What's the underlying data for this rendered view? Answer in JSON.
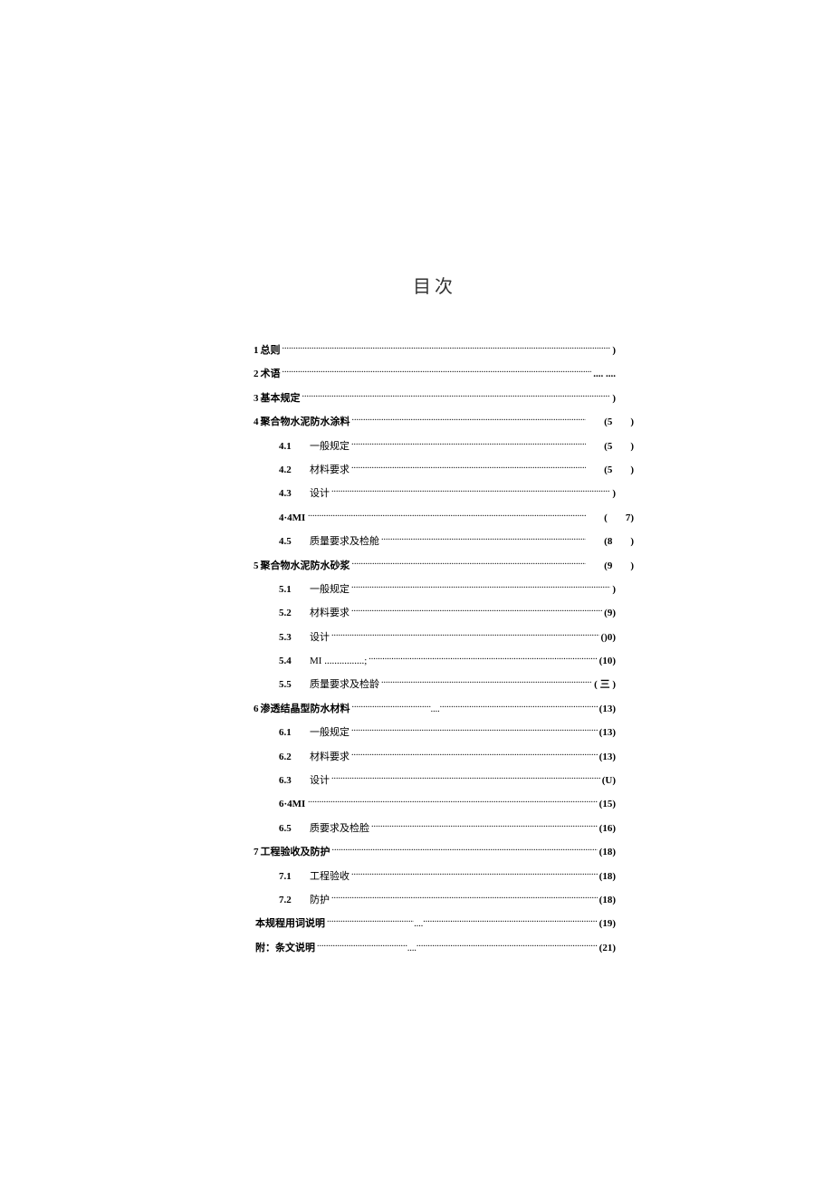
{
  "title": "目次",
  "toc": [
    {
      "type": "top",
      "num": "1",
      "label": "总则",
      "page": ")"
    },
    {
      "type": "top",
      "num": "2",
      "label": "术语",
      "page": ".... ...."
    },
    {
      "type": "top",
      "num": "3",
      "label": "基本规定",
      "page": ")"
    },
    {
      "type": "top",
      "num": "4",
      "label": "聚合物水泥防水涂料",
      "page": "(5",
      "extra": ")"
    },
    {
      "type": "sub",
      "num": "4.1",
      "label": "一般规定",
      "page": "(5",
      "extra": ")"
    },
    {
      "type": "sub",
      "num": "4.2",
      "label": "材料要求",
      "page": "(5",
      "extra": ")"
    },
    {
      "type": "sub",
      "num": "4.3",
      "label": "设计",
      "page": ")"
    },
    {
      "type": "sub",
      "num": "4·4MI",
      "label": "",
      "page": "(",
      "extra": "7)"
    },
    {
      "type": "sub",
      "num": "4.5",
      "label": "质量要求及检舱",
      "page": "(8",
      "extra": ")"
    },
    {
      "type": "top",
      "num": "5",
      "label": "聚合物水泥防水砂浆",
      "page": "(9",
      "extra": ")"
    },
    {
      "type": "sub",
      "num": "5.1",
      "label": "一般规定",
      "page": ")"
    },
    {
      "type": "sub",
      "num": "5.2",
      "label": "材料要求",
      "page": "(9)"
    },
    {
      "type": "sub",
      "num": "5.3",
      "label": "设计",
      "page": "()0)"
    },
    {
      "type": "sub",
      "num": "5.4",
      "label": "MI ................;",
      "page": "(10)"
    },
    {
      "type": "sub",
      "num": "5.5",
      "label": "质量要求及检龄",
      "page": "( 三 )"
    },
    {
      "type": "top",
      "num": "6",
      "label": "渗透结晶型防水材料",
      "gap": true,
      "page": "(13)"
    },
    {
      "type": "sub",
      "num": "6.1",
      "label": "一般规定",
      "page": "(13)"
    },
    {
      "type": "sub",
      "num": "6.2",
      "label": "材料要求",
      "page": "(13)"
    },
    {
      "type": "sub",
      "num": "6.3",
      "label": "设计",
      "page": "(U)"
    },
    {
      "type": "sub",
      "num": "6·4MI",
      "label": "",
      "page": "(15)"
    },
    {
      "type": "sub",
      "num": "6.5",
      "label": "质要求及检脸",
      "page": "(16)"
    },
    {
      "type": "top",
      "num": "7",
      "label": "工程验收及防护",
      "page": "(18)"
    },
    {
      "type": "sub",
      "num": "7.1",
      "label": "工程验收",
      "page": "(18)"
    },
    {
      "type": "sub",
      "num": "7.2",
      "label": "防护",
      "page": "(18)"
    },
    {
      "type": "top",
      "num": "",
      "label": "本规程用词说明",
      "gap": true,
      "page": "(19)"
    },
    {
      "type": "top",
      "num": "",
      "label": "附：条文说明",
      "gap": true,
      "page": "(21)"
    }
  ]
}
